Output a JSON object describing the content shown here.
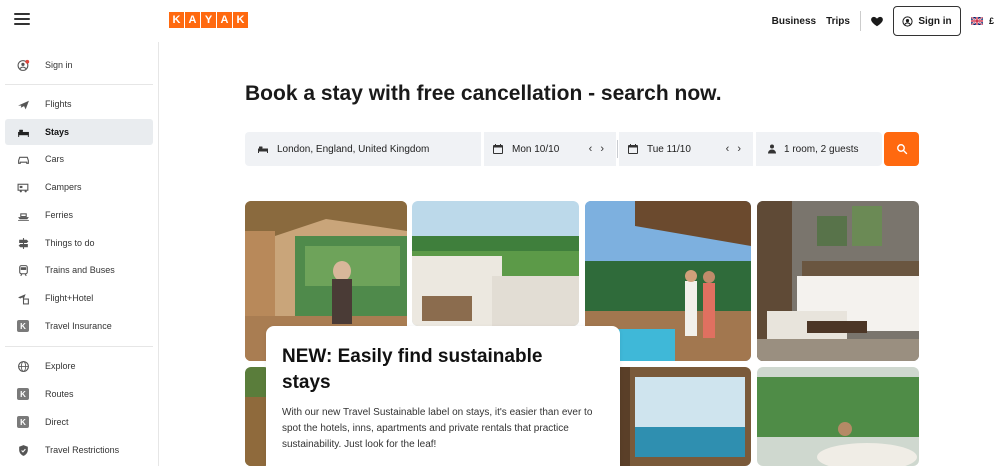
{
  "header": {
    "logo_letters": [
      "K",
      "A",
      "Y",
      "A",
      "K"
    ],
    "brand_color": "#ff690f",
    "business_label": "Business",
    "trips_label": "Trips",
    "sign_in_label": "Sign in",
    "currency": "£"
  },
  "sidebar": {
    "items": [
      {
        "label": "Sign in",
        "icon": "user-icon"
      },
      {
        "label": "Flights",
        "icon": "plane-icon"
      },
      {
        "label": "Stays",
        "icon": "bed-icon",
        "active": true
      },
      {
        "label": "Cars",
        "icon": "car-icon"
      },
      {
        "label": "Campers",
        "icon": "camper-icon"
      },
      {
        "label": "Ferries",
        "icon": "ferry-icon"
      },
      {
        "label": "Things to do",
        "icon": "signpost-icon"
      },
      {
        "label": "Trains and Buses",
        "icon": "train-icon"
      },
      {
        "label": "Flight+Hotel",
        "icon": "flight-hotel-icon"
      },
      {
        "label": "Travel Insurance",
        "icon": "k-badge-icon"
      },
      {
        "label": "Explore",
        "icon": "globe-icon"
      },
      {
        "label": "Routes",
        "icon": "k-badge-icon"
      },
      {
        "label": "Direct",
        "icon": "k-badge-icon"
      },
      {
        "label": "Travel Restrictions",
        "icon": "shield-icon"
      }
    ]
  },
  "main": {
    "headline": "Book a stay with free cancellation - search now.",
    "search": {
      "destination": "London, England, United Kingdom",
      "checkin": "Mon 10/10",
      "checkout": "Tue 11/10",
      "guests": "1 room, 2 guests",
      "prev_arrow": "‹",
      "next_arrow": "›"
    },
    "promo": {
      "title": "NEW: Easily find sustainable stays",
      "body": "With our new Travel Sustainable label on stays, it's easier than ever to spot the hotels, inns, apartments and private rentals that practice sustainability. Just look for the leaf!"
    }
  }
}
